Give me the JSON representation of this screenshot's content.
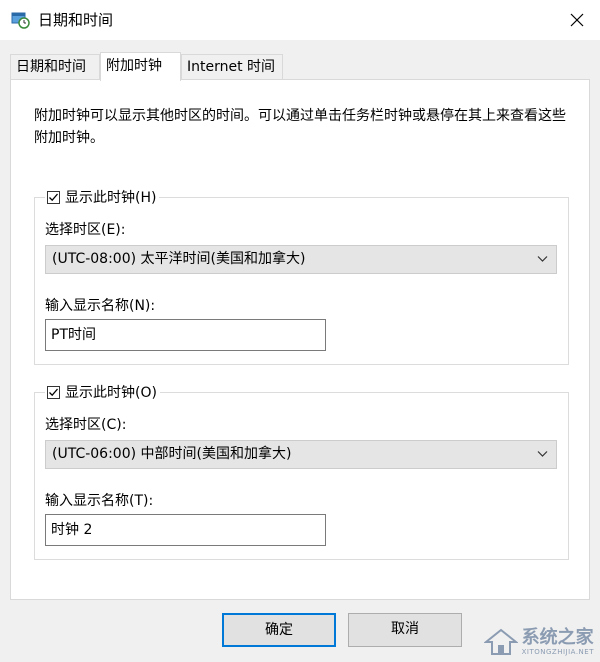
{
  "window": {
    "title": "日期和时间"
  },
  "tabs": [
    {
      "label": "日期和时间"
    },
    {
      "label": "附加时钟"
    },
    {
      "label": "Internet 时间"
    }
  ],
  "description": "附加时钟可以显示其他时区的时间。可以通过单击任务栏时钟或悬停在其上来查看这些附加时钟。",
  "clock1": {
    "checkbox_label": "显示此时钟(H)",
    "checked": true,
    "timezone_label": "选择时区(E):",
    "timezone_value": "(UTC-08:00) 太平洋时间(美国和加拿大)",
    "name_label": "输入显示名称(N):",
    "name_value": "PT时间"
  },
  "clock2": {
    "checkbox_label": "显示此时钟(O)",
    "checked": true,
    "timezone_label": "选择时区(C):",
    "timezone_value": "(UTC-06:00) 中部时间(美国和加拿大)",
    "name_label": "输入显示名称(T):",
    "name_value": "时钟 2"
  },
  "buttons": {
    "ok": "确定",
    "cancel": "取消"
  },
  "watermark": {
    "main": "系统之家",
    "sub": "XITONGZHIJIA.NET"
  }
}
